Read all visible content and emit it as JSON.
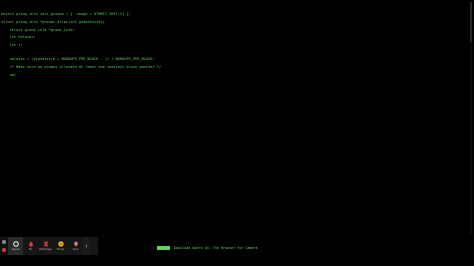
{
  "code": {
    "lines": [
      "extern group_info init_groups = { .usage = ATOMIC_INIT(2) };",
      "struct group_info *groups_alloc(int gidsetsize){",
      "    struct group_info *group_info;",
      "    int nblocks;",
      "    int i;",
      "    nblocks = (gidsetsize + NGROUPS_PER_BLOCK - 1) / NGROUPS_PER_BLOCK;",
      "    /* Make sure we always allocate at least one indirect block pointer */",
      "    nbl"
    ]
  },
  "taskbar": {
    "items": [
      {
        "label": "Opera",
        "icon": "opera-gx-icon",
        "color": "#ffffff"
      },
      {
        "label": "Fix",
        "icon": "flame-icon",
        "color": "#d23a4a"
      },
      {
        "label": "Rampage",
        "icon": "rampage-icon",
        "color": "#c2334a"
      },
      {
        "label": "Emoji",
        "icon": "smiley-icon",
        "color": "#f2b532"
      },
      {
        "label": "Cool",
        "icon": "ice-cream-icon",
        "color": "#e26fa6"
      }
    ],
    "collapse_glyph": "‹"
  },
  "banner": {
    "text": "Download Opera GX: The Browser for Gamers",
    "badge_color": "#5fd35f"
  },
  "colors": {
    "background": "#000000",
    "code_text": "#5fd35f"
  }
}
